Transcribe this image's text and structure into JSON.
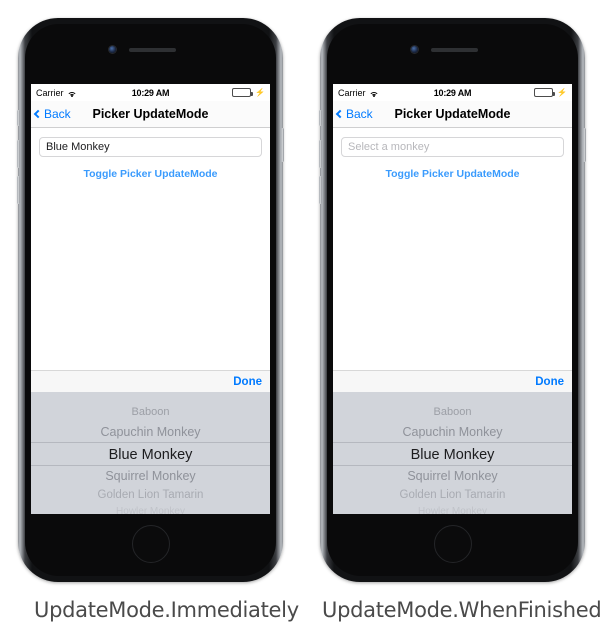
{
  "phones": [
    {
      "caption": "UpdateMode.Immediately",
      "statusbar": {
        "carrier": "Carrier",
        "time": "10:29 AM",
        "wifi_icon": "wifi-icon",
        "battery_icon": "battery-icon",
        "charging_icon": "lightning-bolt-icon"
      },
      "navbar": {
        "back_label": "Back",
        "back_icon": "chevron-left-icon",
        "title": "Picker UpdateMode"
      },
      "content": {
        "textfield_value": "Blue Monkey",
        "textfield_placeholder": "Select a monkey",
        "toggle_label": "Toggle Picker UpdateMode"
      },
      "picker": {
        "done_label": "Done",
        "rows": [
          "Baboon",
          "Capuchin Monkey",
          "Blue Monkey",
          "Squirrel Monkey",
          "Golden Lion Tamarin",
          "Howler Monkey"
        ],
        "selected_index": 2
      }
    },
    {
      "caption": "UpdateMode.WhenFinished",
      "statusbar": {
        "carrier": "Carrier",
        "time": "10:29 AM",
        "wifi_icon": "wifi-icon",
        "battery_icon": "battery-icon",
        "charging_icon": "lightning-bolt-icon"
      },
      "navbar": {
        "back_label": "Back",
        "back_icon": "chevron-left-icon",
        "title": "Picker UpdateMode"
      },
      "content": {
        "textfield_value": "",
        "textfield_placeholder": "Select a monkey",
        "toggle_label": "Toggle Picker UpdateMode"
      },
      "picker": {
        "done_label": "Done",
        "rows": [
          "Baboon",
          "Capuchin Monkey",
          "Blue Monkey",
          "Squirrel Monkey",
          "Golden Lion Tamarin",
          "Howler Monkey"
        ],
        "selected_index": 2
      }
    }
  ],
  "colors": {
    "ios_blue": "#007aff",
    "link_blue": "#3a9bfd",
    "picker_bg": "#d1d4da",
    "battery_green": "#4cd964"
  }
}
